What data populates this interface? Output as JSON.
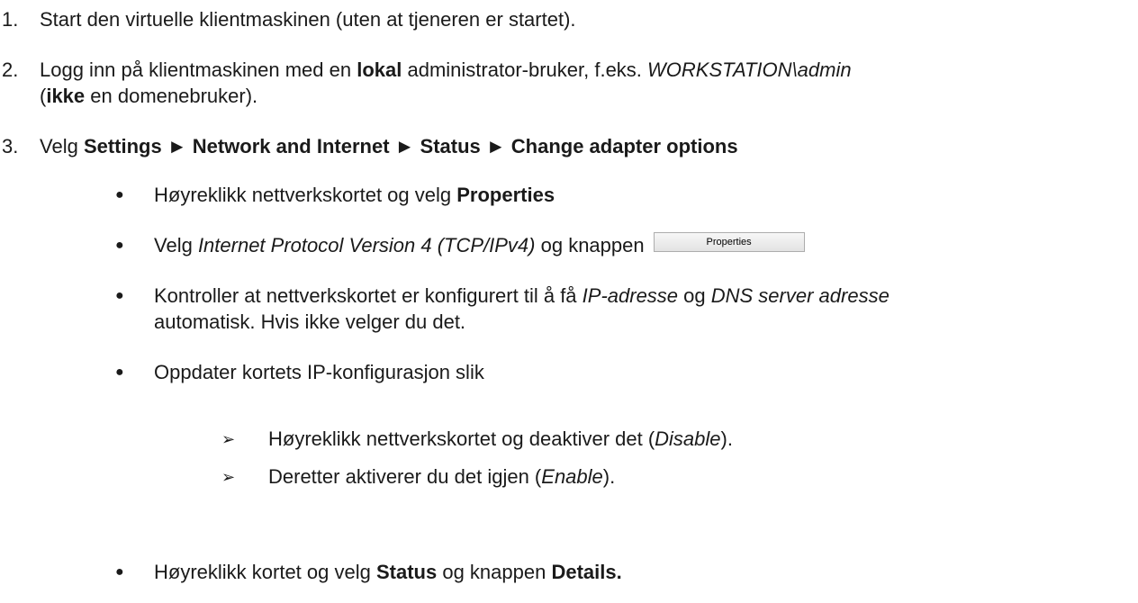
{
  "steps": [
    {
      "num": "1.",
      "parts": [
        {
          "t": "Start den virtuelle klientmaskinen (uten at tjeneren er startet).",
          "s": ""
        }
      ]
    },
    {
      "num": "2.",
      "parts": [
        {
          "t": "Logg inn på klientmaskinen med en ",
          "s": ""
        },
        {
          "t": "lokal",
          "s": "b"
        },
        {
          "t": " administrator-bruker, f.eks. ",
          "s": ""
        },
        {
          "t": "WORKSTATION\\admin",
          "s": "i"
        }
      ],
      "parts2": [
        {
          "t": "(",
          "s": ""
        },
        {
          "t": "ikke",
          "s": "b"
        },
        {
          "t": " en domenebruker).",
          "s": ""
        }
      ]
    },
    {
      "num": "3.",
      "parts": [
        {
          "t": "Velg ",
          "s": ""
        },
        {
          "t": "Settings ► Network and Internet ► Status ► Change adapter options",
          "s": "b"
        }
      ]
    }
  ],
  "bullets": [
    {
      "parts": [
        {
          "t": "Høyreklikk nettverkskortet og velg ",
          "s": ""
        },
        {
          "t": "Properties",
          "s": "b"
        }
      ]
    },
    {
      "parts": [
        {
          "t": "Velg ",
          "s": ""
        },
        {
          "t": "Internet Protocol Version 4 (TCP/IPv4)",
          "s": "i"
        },
        {
          "t": " og knappen",
          "s": ""
        }
      ],
      "button": "Properties"
    },
    {
      "parts": [
        {
          "t": "Kontroller at nettverkskortet er konfigurert til å få ",
          "s": ""
        },
        {
          "t": "IP-adresse",
          "s": "i"
        },
        {
          "t": " og ",
          "s": ""
        },
        {
          "t": "DNS server adresse",
          "s": "i"
        }
      ],
      "parts2": [
        {
          "t": "automatisk. Hvis ikke velger du det.",
          "s": ""
        }
      ]
    },
    {
      "parts": [
        {
          "t": "Oppdater kortets IP-konfigurasjon slik",
          "s": ""
        }
      ]
    }
  ],
  "subbullets": [
    {
      "parts": [
        {
          "t": "Høyreklikk nettverkskortet og deaktiver det (",
          "s": ""
        },
        {
          "t": "Disable",
          "s": "i"
        },
        {
          "t": ").",
          "s": ""
        }
      ]
    },
    {
      "parts": [
        {
          "t": "Deretter aktiverer du det igjen (",
          "s": ""
        },
        {
          "t": "Enable",
          "s": "i"
        },
        {
          "t": ").",
          "s": ""
        }
      ]
    }
  ],
  "last_bullet": {
    "parts": [
      {
        "t": "Høyreklikk kortet og velg ",
        "s": ""
      },
      {
        "t": "Status",
        "s": "b"
      },
      {
        "t": " og knappen ",
        "s": ""
      },
      {
        "t": "Details.",
        "s": "b"
      }
    ]
  }
}
